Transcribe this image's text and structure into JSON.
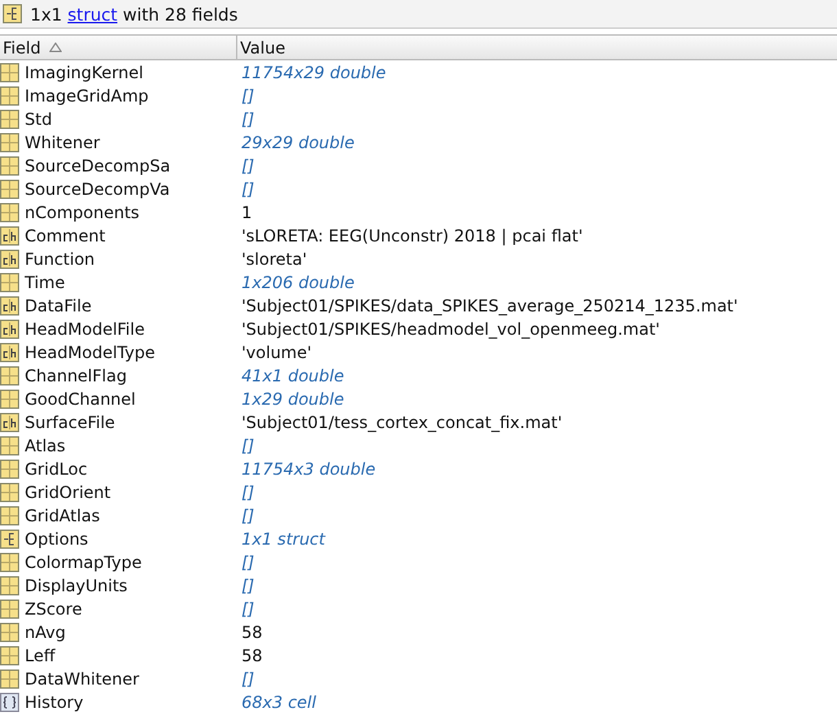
{
  "summary": {
    "prefix": "1x1",
    "link": "struct",
    "suffix": "with 28 fields"
  },
  "columns": [
    {
      "label": "Field",
      "sorted": true
    },
    {
      "label": "Value",
      "sorted": false
    }
  ],
  "rows": [
    {
      "kind": "matrix",
      "field": "ImagingKernel",
      "value": "11754x29 double",
      "summary": true
    },
    {
      "kind": "matrix",
      "field": "ImageGridAmp",
      "value": "[]",
      "summary": true
    },
    {
      "kind": "matrix",
      "field": "Std",
      "value": "[]",
      "summary": true
    },
    {
      "kind": "matrix",
      "field": "Whitener",
      "value": "29x29 double",
      "summary": true
    },
    {
      "kind": "matrix",
      "field": "SourceDecompSa",
      "value": "[]",
      "summary": true
    },
    {
      "kind": "matrix",
      "field": "SourceDecompVa",
      "value": "[]",
      "summary": true
    },
    {
      "kind": "matrix",
      "field": "nComponents",
      "value": "1",
      "summary": false
    },
    {
      "kind": "char",
      "field": "Comment",
      "value": "'sLORETA: EEG(Unconstr) 2018 | pcai flat'",
      "summary": false
    },
    {
      "kind": "char",
      "field": "Function",
      "value": "'sloreta'",
      "summary": false
    },
    {
      "kind": "matrix",
      "field": "Time",
      "value": "1x206 double",
      "summary": true
    },
    {
      "kind": "char",
      "field": "DataFile",
      "value": "'Subject01/SPIKES/data_SPIKES_average_250214_1235.mat'",
      "summary": false
    },
    {
      "kind": "char",
      "field": "HeadModelFile",
      "value": "'Subject01/SPIKES/headmodel_vol_openmeeg.mat'",
      "summary": false
    },
    {
      "kind": "char",
      "field": "HeadModelType",
      "value": "'volume'",
      "summary": false
    },
    {
      "kind": "matrix",
      "field": "ChannelFlag",
      "value": "41x1 double",
      "summary": true
    },
    {
      "kind": "matrix",
      "field": "GoodChannel",
      "value": "1x29 double",
      "summary": true
    },
    {
      "kind": "char",
      "field": "SurfaceFile",
      "value": "'Subject01/tess_cortex_concat_fix.mat'",
      "summary": false
    },
    {
      "kind": "matrix",
      "field": "Atlas",
      "value": "[]",
      "summary": true
    },
    {
      "kind": "matrix",
      "field": "GridLoc",
      "value": "11754x3 double",
      "summary": true
    },
    {
      "kind": "matrix",
      "field": "GridOrient",
      "value": "[]",
      "summary": true
    },
    {
      "kind": "matrix",
      "field": "GridAtlas",
      "value": "[]",
      "summary": true
    },
    {
      "kind": "struct",
      "field": "Options",
      "value": "1x1 struct",
      "summary": true
    },
    {
      "kind": "matrix",
      "field": "ColormapType",
      "value": "[]",
      "summary": true
    },
    {
      "kind": "matrix",
      "field": "DisplayUnits",
      "value": "[]",
      "summary": true
    },
    {
      "kind": "matrix",
      "field": "ZScore",
      "value": "[]",
      "summary": true
    },
    {
      "kind": "matrix",
      "field": "nAvg",
      "value": "58",
      "summary": false
    },
    {
      "kind": "matrix",
      "field": "Leff",
      "value": "58",
      "summary": false
    },
    {
      "kind": "matrix",
      "field": "DataWhitener",
      "value": "[]",
      "summary": true
    },
    {
      "kind": "cell",
      "field": "History",
      "value": "68x3 cell",
      "summary": true
    }
  ]
}
